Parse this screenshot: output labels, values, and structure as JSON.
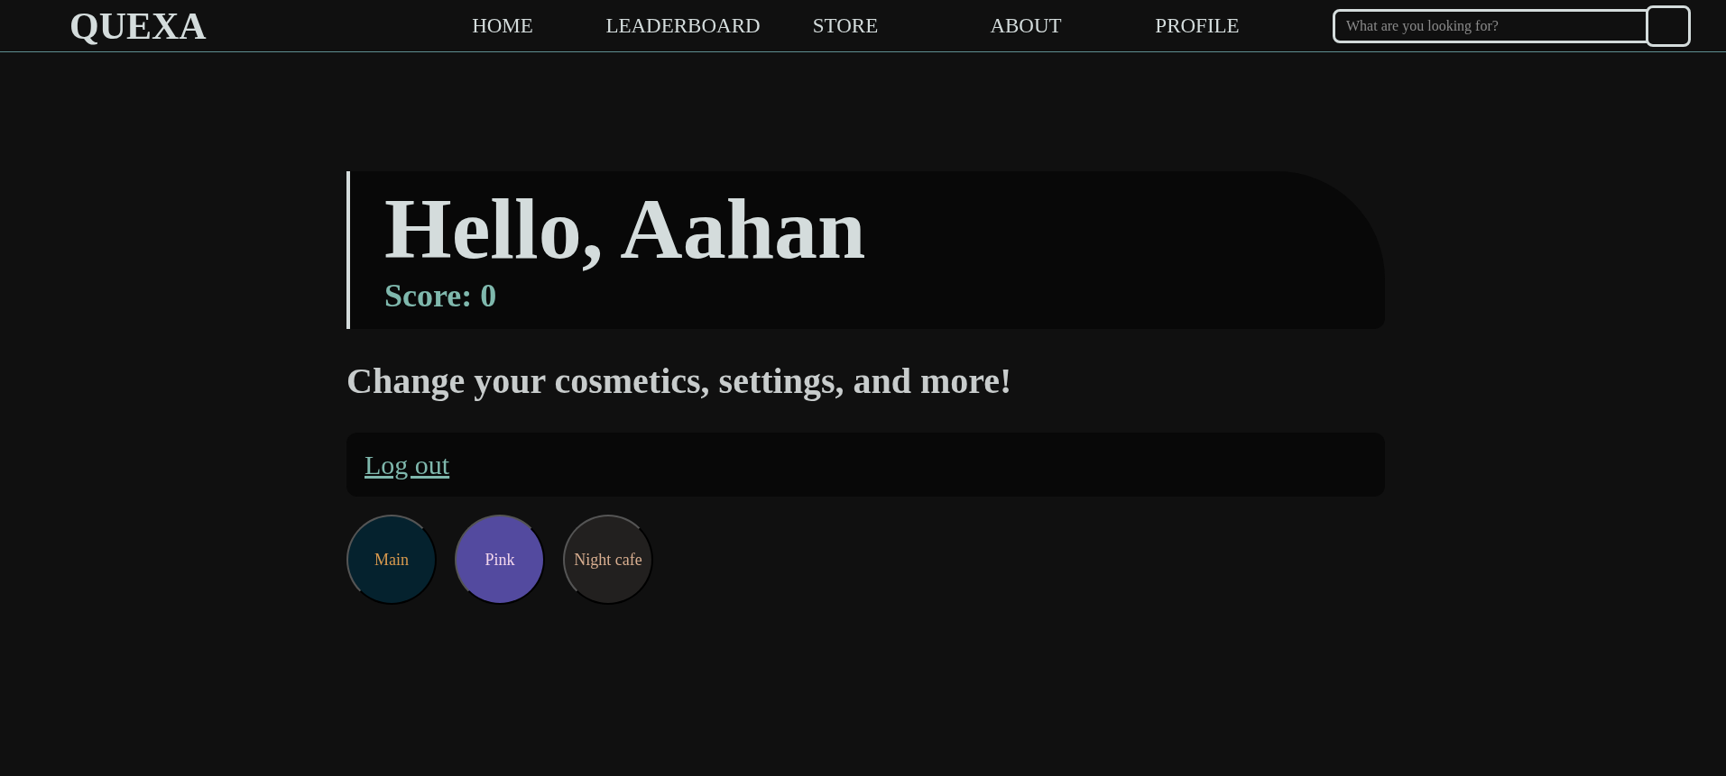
{
  "logo": "QUEXA",
  "nav": [
    {
      "label": "HOME"
    },
    {
      "label": "LEADERBOARD"
    },
    {
      "label": "STORE"
    },
    {
      "label": "ABOUT"
    },
    {
      "label": "PROFILE"
    }
  ],
  "search": {
    "placeholder": "What are you looking for?"
  },
  "greeting": "Hello, Aahan",
  "score": "Score: 0",
  "subtitle": "Change your cosmetics, settings, and more!",
  "logout": "Log out",
  "themes": [
    {
      "label": "Main",
      "color": "#05222e"
    },
    {
      "label": "Pink",
      "color": "#534a9f"
    },
    {
      "label": "Night cafe",
      "color": "#22201f"
    }
  ]
}
